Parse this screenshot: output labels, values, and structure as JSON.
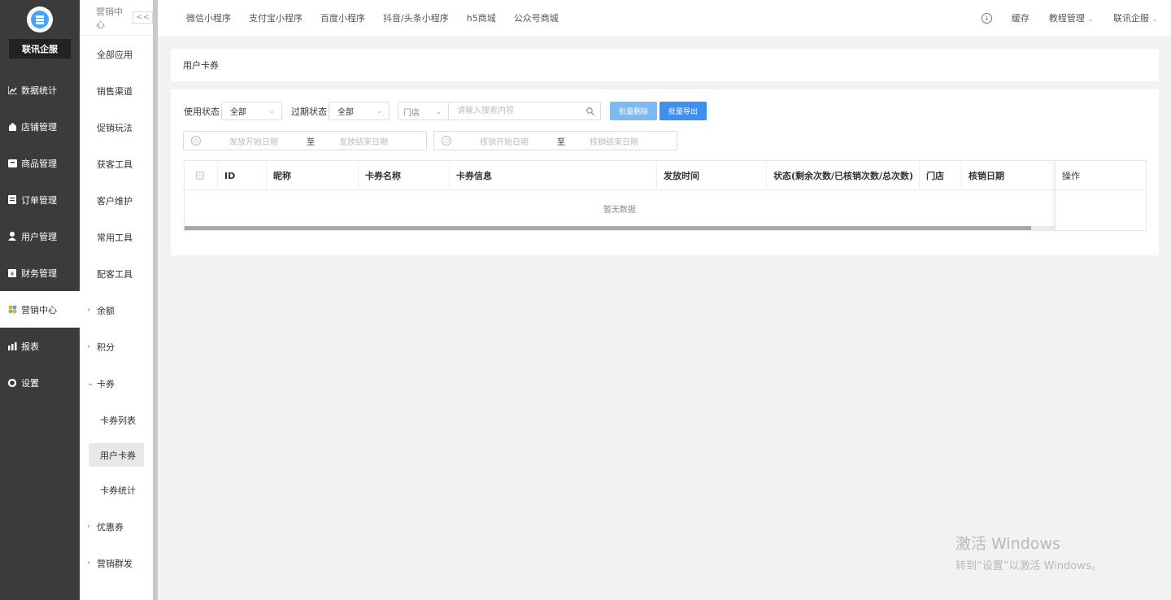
{
  "brand": {
    "name": "联讯企服"
  },
  "nav": [
    {
      "label": "数据统计",
      "icon": "chart-icon"
    },
    {
      "label": "店铺管理",
      "icon": "store-icon"
    },
    {
      "label": "商品管理",
      "icon": "goods-icon"
    },
    {
      "label": "订单管理",
      "icon": "order-icon"
    },
    {
      "label": "用户管理",
      "icon": "user-icon"
    },
    {
      "label": "财务管理",
      "icon": "finance-icon"
    },
    {
      "label": "营销中心",
      "icon": "marketing-icon",
      "active": true
    },
    {
      "label": "报表",
      "icon": "report-icon"
    },
    {
      "label": "设置",
      "icon": "settings-icon"
    }
  ],
  "subnav": {
    "title": "营销中心",
    "collapse": "<<",
    "items": [
      "全部应用",
      "销售渠道",
      "促销玩法",
      "获客工具",
      "客户维护",
      "常用工具",
      "配客工具"
    ],
    "groups": [
      {
        "label": "余额",
        "arrow": ">"
      },
      {
        "label": "积分",
        "arrow": ">"
      },
      {
        "label": "卡券",
        "arrow": "v"
      }
    ],
    "card_children": [
      "卡券列表",
      "用户卡券",
      "卡券统计"
    ],
    "tail_groups": [
      {
        "label": "优惠券",
        "arrow": ">"
      },
      {
        "label": "营销群发",
        "arrow": ">"
      }
    ]
  },
  "topbar": {
    "tabs": [
      "微信小程序",
      "支付宝小程序",
      "百度小程序",
      "抖音/头条小程序",
      "h5商城",
      "公众号商城"
    ],
    "cache": "缓存",
    "tutorial": "教程管理",
    "account": "联讯企服"
  },
  "page": {
    "title": "用户卡券",
    "filters": {
      "use_status_label": "使用状态",
      "use_status_value": "全部",
      "expire_status_label": "过期状态",
      "expire_status_value": "全部",
      "store_select": "门店",
      "search_placeholder": "请输入搜索内容",
      "batch_delete": "批量删除",
      "batch_export": "批量导出",
      "issue_start": "发放开始日期",
      "issue_to": "至",
      "issue_end": "发放结束日期",
      "verify_start": "核销开始日期",
      "verify_to": "至",
      "verify_end": "核销结束日期"
    },
    "table": {
      "columns": [
        "ID",
        "昵称",
        "卡券名称",
        "卡券信息",
        "发放时间",
        "状态(剩余次数/已核销次数/总次数)",
        "门店",
        "核销日期"
      ],
      "op_column": "操作",
      "empty": "暂无数据"
    }
  },
  "watermark": {
    "line1": "激活 Windows",
    "line2": "转到“设置”以激活 Windows。"
  }
}
